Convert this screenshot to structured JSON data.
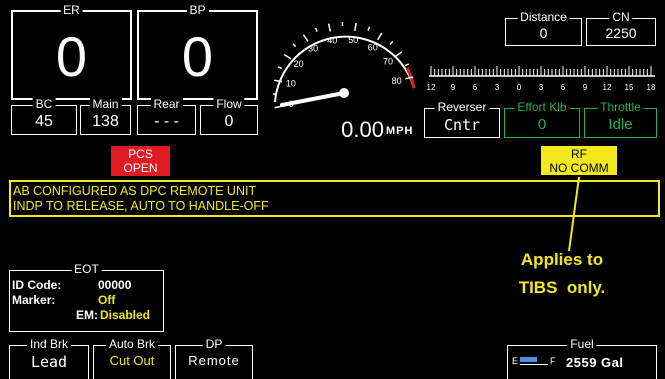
{
  "top": {
    "er": {
      "label": "ER",
      "value": "0"
    },
    "bp": {
      "label": "BP",
      "value": "0"
    },
    "bc": {
      "label": "BC",
      "value": "45"
    },
    "main": {
      "label": "Main",
      "value": "138"
    },
    "rear": {
      "label": "Rear",
      "value": "- - -"
    },
    "flow": {
      "label": "Flow",
      "value": "0"
    }
  },
  "speedometer": {
    "ticks": [
      "0",
      "10",
      "20",
      "30",
      "40",
      "50",
      "60",
      "70",
      "80"
    ],
    "speed": "0.00",
    "unit": "MPH",
    "needle_value": 0
  },
  "right": {
    "distance": {
      "label": "Distance",
      "value": "0"
    },
    "cn": {
      "label": "CN",
      "value": "2250"
    },
    "effort_scale": [
      "12",
      "9",
      "6",
      "3",
      "0",
      "3",
      "6",
      "9",
      "12",
      "15",
      "18"
    ],
    "reverser": {
      "label": "Reverser",
      "value": "Cntr"
    },
    "effort": {
      "label": "Effort Klb",
      "value": "0"
    },
    "throttle": {
      "label": "Throttle",
      "value": "Idle"
    }
  },
  "alerts": {
    "pcs": {
      "line1": "PCS",
      "line2": "OPEN"
    },
    "rf": {
      "line1": "RF",
      "line2": "NO COMM"
    }
  },
  "message": {
    "line1": "AB CONFIGURED AS DPC REMOTE UNIT",
    "line2": "INDP TO RELEASE, AUTO TO HANDLE-OFF"
  },
  "annotation": {
    "line1": "Applies to",
    "line2": "TIBS  only."
  },
  "eot": {
    "title": "EOT",
    "rows": [
      {
        "label": "ID Code:",
        "value": "00000"
      },
      {
        "label": "Marker:",
        "value": "Off"
      },
      {
        "label": "EM:",
        "value": "Disabled"
      }
    ]
  },
  "bottom": {
    "ind_brk": {
      "label": "Ind Brk",
      "value": "Lead"
    },
    "auto_brk": {
      "label": "Auto Brk",
      "value": "Cut Out"
    },
    "dp": {
      "label": "DP",
      "value": "Remote"
    },
    "fuel": {
      "label": "Fuel",
      "value": "2559 Gal",
      "gauge_e": "E",
      "gauge_f": "F",
      "level": 0.6
    }
  },
  "colors": {
    "pcs_bg": "#e01b24",
    "rf_bg": "#f3e81c",
    "message": "#f3e81c",
    "green": "#27b14a",
    "annotation": "#f3e81c"
  }
}
